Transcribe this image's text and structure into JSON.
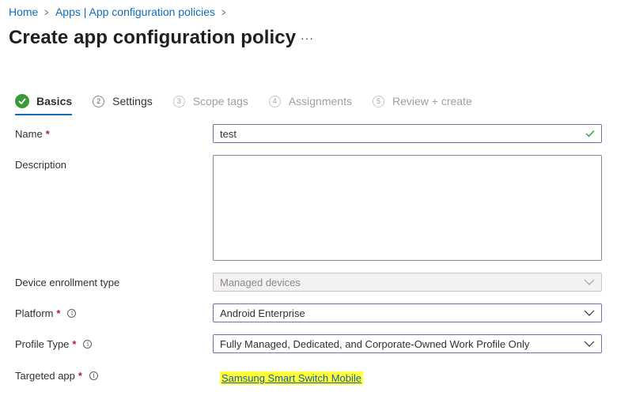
{
  "breadcrumb": {
    "home": "Home",
    "parent": "Apps | App configuration policies"
  },
  "page": {
    "title": "Create app configuration policy",
    "more": "···"
  },
  "steps": [
    {
      "num": "",
      "label": "Basics",
      "state": "active"
    },
    {
      "num": "2",
      "label": "Settings",
      "state": "enabled"
    },
    {
      "num": "3",
      "label": "Scope tags",
      "state": "disabled"
    },
    {
      "num": "4",
      "label": "Assignments",
      "state": "disabled"
    },
    {
      "num": "5",
      "label": "Review + create",
      "state": "disabled"
    }
  ],
  "form": {
    "name": {
      "label": "Name",
      "required": "*",
      "value": "test"
    },
    "description": {
      "label": "Description",
      "value": ""
    },
    "enrollment": {
      "label": "Device enrollment type",
      "value": "Managed devices"
    },
    "platform": {
      "label": "Platform",
      "required": "*",
      "info": "i",
      "value": "Android Enterprise"
    },
    "profile_type": {
      "label": "Profile Type",
      "required": "*",
      "info": "i",
      "value": "Fully Managed, Dedicated, and Corporate-Owned Work Profile Only"
    },
    "targeted_app": {
      "label": "Targeted app",
      "required": "*",
      "info": "i",
      "value": "Samsung Smart Switch Mobile"
    }
  },
  "colors": {
    "link": "#0f6cbd",
    "focus_border": "#8764b8",
    "success": "#3a9a3a",
    "required": "#a4262c",
    "highlight": "#ffff3a"
  },
  "icons": {
    "breadcrumb_separator": "chevron-right-icon",
    "valid": "checkmark-icon",
    "dropdown": "chevron-down-icon",
    "info": "info-icon",
    "step_complete": "checkmark-circle-icon"
  }
}
